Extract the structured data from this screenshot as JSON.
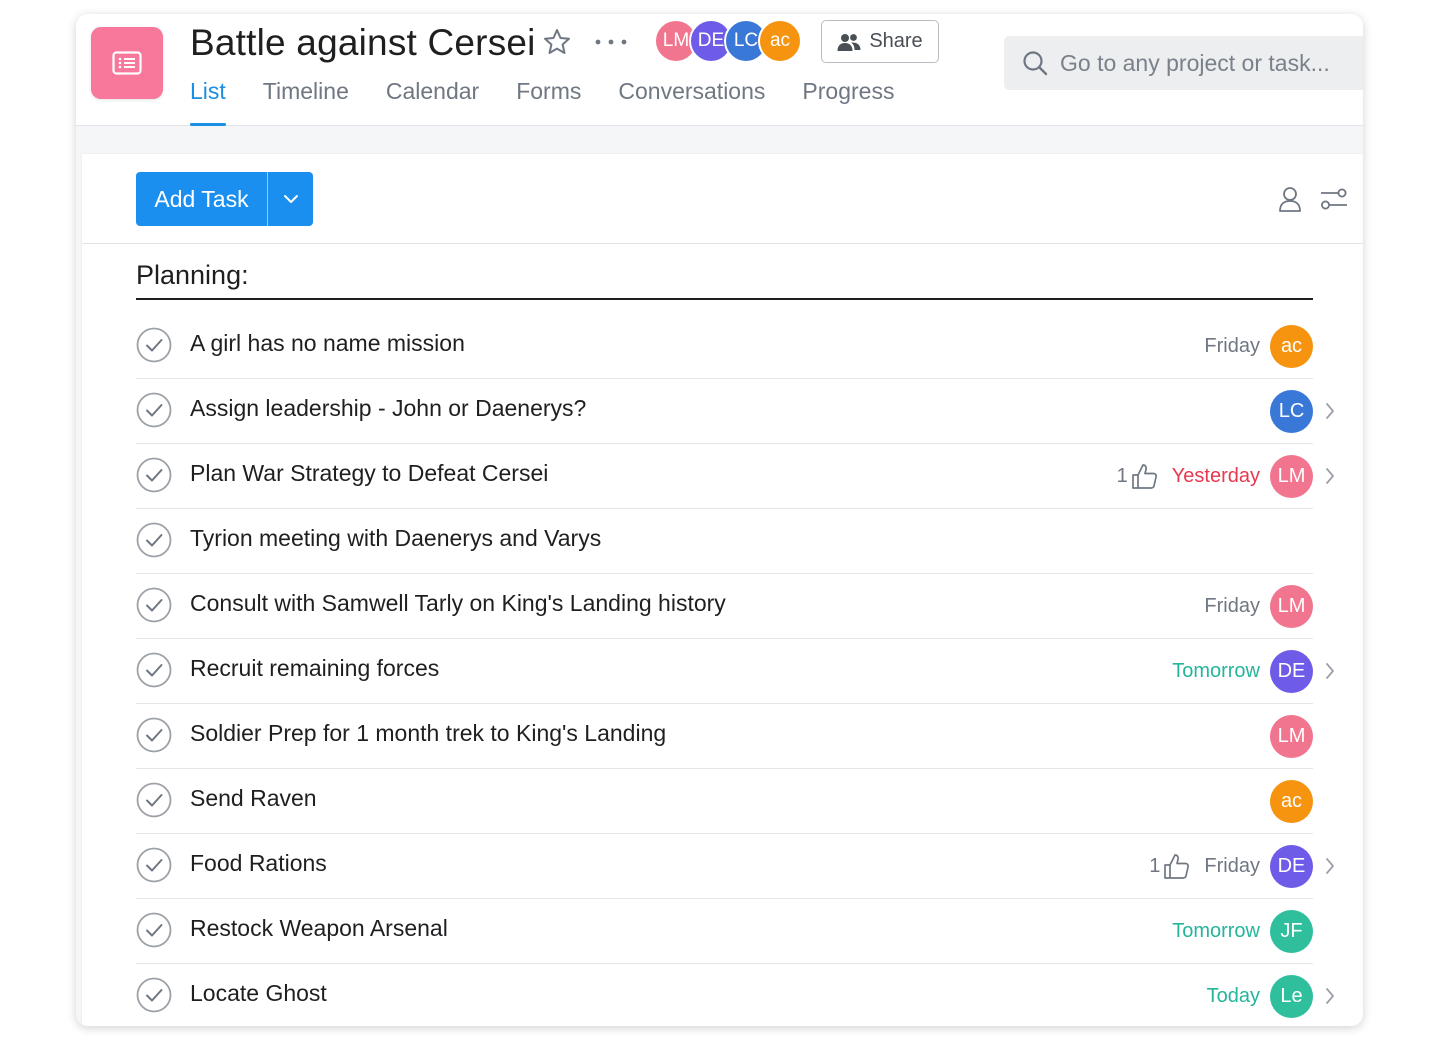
{
  "project": {
    "title": "Battle against Cersei",
    "icon": "list-icon",
    "color": "#f7789a"
  },
  "header_members": [
    {
      "initials": "LM",
      "color": "#f27590"
    },
    {
      "initials": "DE",
      "color": "#6e5ce8"
    },
    {
      "initials": "LC",
      "color": "#3a78d8"
    },
    {
      "initials": "ac",
      "color": "#f6930f"
    }
  ],
  "share": {
    "label": "Share",
    "icon": "people-icon"
  },
  "tabs": [
    {
      "label": "List",
      "active": true
    },
    {
      "label": "Timeline",
      "active": false
    },
    {
      "label": "Calendar",
      "active": false
    },
    {
      "label": "Forms",
      "active": false
    },
    {
      "label": "Conversations",
      "active": false
    },
    {
      "label": "Progress",
      "active": false
    }
  ],
  "search": {
    "placeholder": "Go to any project or task..."
  },
  "toolbar": {
    "add_task_label": "Add Task"
  },
  "section": {
    "title": "Planning:"
  },
  "due_colors": {
    "Friday": "#6f7782",
    "Yesterday": "#e8384f",
    "Tomorrow": "#25b59b",
    "Today": "#25b59b"
  },
  "tasks": [
    {
      "name": "A girl has no name mission",
      "due": "Friday",
      "due_kind": "friday",
      "likes": "",
      "assignee": "ac",
      "assignee_color": "#f6930f",
      "has_subtasks": false
    },
    {
      "name": "Assign leadership - John or Daenerys?",
      "due": "",
      "due_kind": "",
      "likes": "",
      "assignee": "LC",
      "assignee_color": "#3a78d8",
      "has_subtasks": true
    },
    {
      "name": "Plan War Strategy to Defeat Cersei",
      "due": "Yesterday",
      "due_kind": "yesterday",
      "likes": "1",
      "assignee": "LM",
      "assignee_color": "#f27590",
      "has_subtasks": true
    },
    {
      "name": "Tyrion meeting with Daenerys and Varys",
      "due": "",
      "due_kind": "",
      "likes": "",
      "assignee": "",
      "assignee_color": "",
      "has_subtasks": false
    },
    {
      "name": "Consult with Samwell Tarly on King's Landing history",
      "due": "Friday",
      "due_kind": "friday",
      "likes": "",
      "assignee": "LM",
      "assignee_color": "#f27590",
      "has_subtasks": false
    },
    {
      "name": "Recruit remaining forces",
      "due": "Tomorrow",
      "due_kind": "tomorrow",
      "likes": "",
      "assignee": "DE",
      "assignee_color": "#6e5ce8",
      "has_subtasks": true
    },
    {
      "name": "Soldier Prep for 1 month trek to King's Landing",
      "due": "",
      "due_kind": "",
      "likes": "",
      "assignee": "LM",
      "assignee_color": "#f27590",
      "has_subtasks": false
    },
    {
      "name": "Send Raven",
      "due": "",
      "due_kind": "",
      "likes": "",
      "assignee": "ac",
      "assignee_color": "#f6930f",
      "has_subtasks": false
    },
    {
      "name": "Food Rations",
      "due": "Friday",
      "due_kind": "friday",
      "likes": "1",
      "assignee": "DE",
      "assignee_color": "#6e5ce8",
      "has_subtasks": true
    },
    {
      "name": "Restock Weapon Arsenal",
      "due": "Tomorrow",
      "due_kind": "tomorrow",
      "likes": "",
      "assignee": "JF",
      "assignee_color": "#2fbf9c",
      "has_subtasks": false
    },
    {
      "name": "Locate Ghost",
      "due": "Today",
      "due_kind": "today",
      "likes": "",
      "assignee": "Le",
      "assignee_color": "#2fbf9c",
      "has_subtasks": true
    }
  ]
}
